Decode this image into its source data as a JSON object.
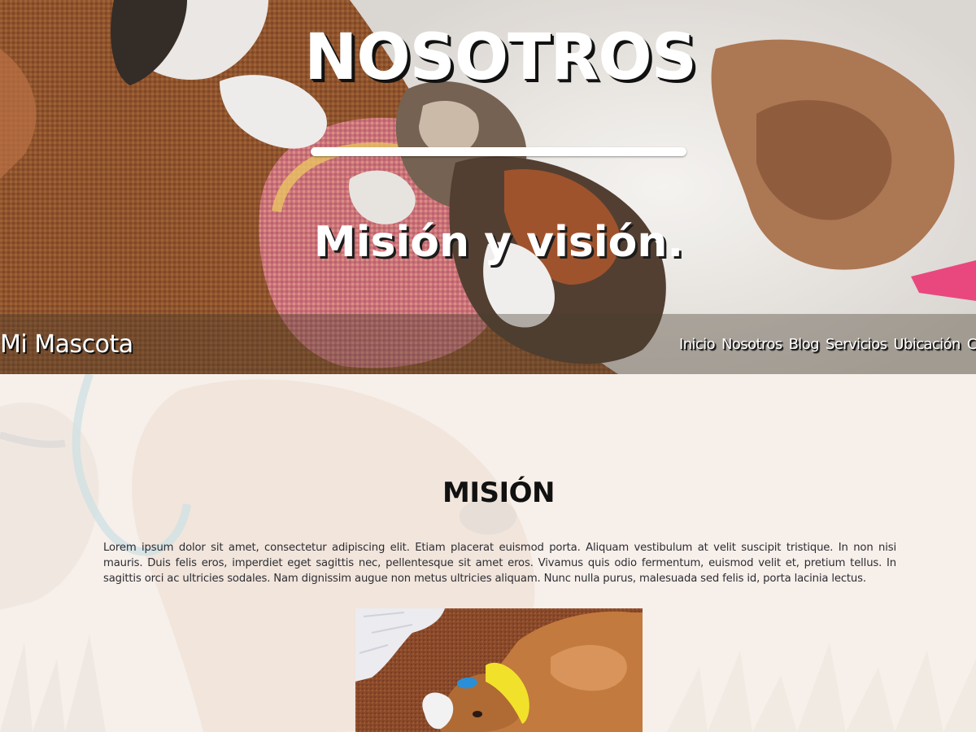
{
  "hero": {
    "title": "NOSOTROS",
    "subtitle": "Misión y visión.",
    "background_image": "cats-and-dog-on-rug"
  },
  "navbar": {
    "brand": "Mi Mascota",
    "links": [
      {
        "label": "Inicio"
      },
      {
        "label": "Nosotros"
      },
      {
        "label": "Blog"
      },
      {
        "label": "Servicios"
      },
      {
        "label": "Ubicación"
      },
      {
        "label": "Contacto"
      }
    ]
  },
  "mision": {
    "title": "MISIÓN",
    "text": "Lorem ipsum dolor sit amet, consectetur adipiscing elit. Etiam placerat euismod porta. Aliquam vestibulum at velit suscipit tristique. In non nisi mauris. Duis felis eros, imperdiet eget sagittis nec, pellentesque sit amet eros. Vivamus quis odio fermentum, euismod velit et, pretium tellus. In sagittis orci ac ultricies sodales. Nam dignissim augue non metus ultricies aliquam. Nunc nulla purus, malesuada sed felis id, porta lacinia lectus.",
    "photo": "puppy-with-yellow-collar"
  },
  "colors": {
    "page_background": "#f6eee9",
    "navbar_overlay": "rgba(70,60,45,0.38)",
    "heading_text": "#111111",
    "body_text": "#2d2d33"
  }
}
